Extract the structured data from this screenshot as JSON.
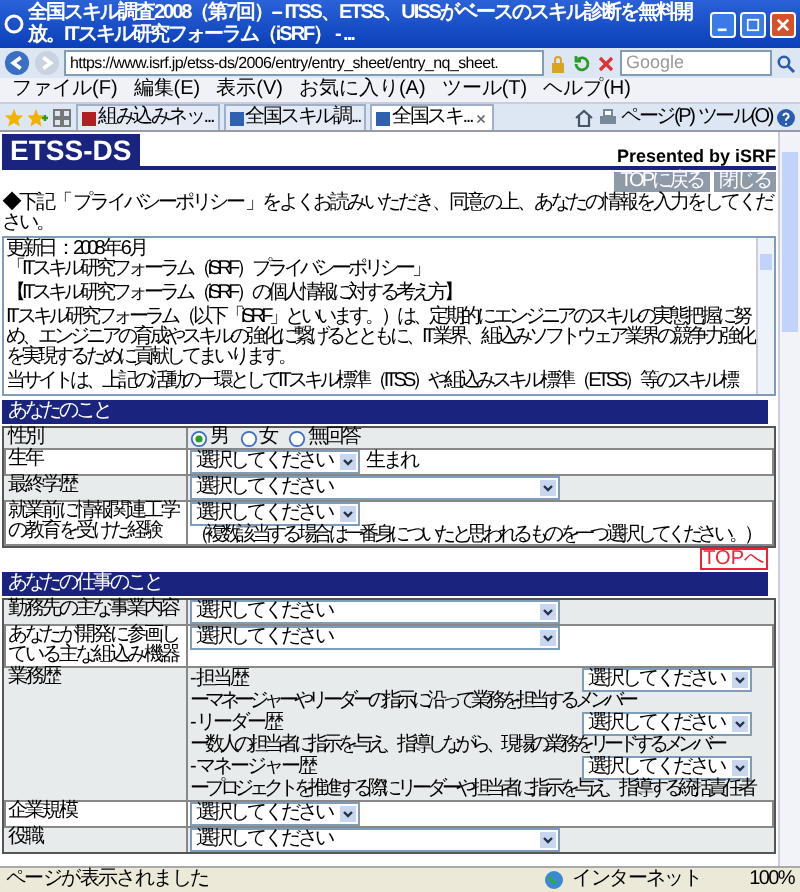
{
  "window": {
    "title": "全国スキル調査2008（第7回）-- ITSS、ETSS、UISSがベースのスキル診断を無料開放。ITスキル研究フォーラム（iSRF） - ..."
  },
  "address_bar": {
    "url": "https://www.isrf.jp/etss-ds/2006/entry/entry_sheet/entry_nq_sheet.",
    "search_placeholder": "Google"
  },
  "menu": [
    "ファイル(F)",
    "編集(E)",
    "表示(V)",
    "お気に入り(A)",
    "ツール(T)",
    "ヘルプ(H)"
  ],
  "tabs": [
    {
      "label": "組み込みネッ...",
      "selected": false
    },
    {
      "label": "全国スキル調...",
      "selected": false
    },
    {
      "label": "全国スキ...",
      "selected": true
    }
  ],
  "toolbar": [
    "ページ(P)",
    "ツール(O)"
  ],
  "page": {
    "logo": "ETSS-DS",
    "presented_by": "Presented by iSRF",
    "buttons": [
      "TOPに戻る",
      "閉じる"
    ],
    "instruction": "◆下記「 プライバシーポリシー 」をよくお読みいただき、同意の上、あなたの情報を入力をしてください。",
    "policy_paragraphs": [
      [
        "更新日 ： 2008 年 6 月",
        "「ITスキル研究フォーラム（iSRF）プライバシーポリシー」"
      ],
      [
        "【ITスキル研究フォーラム（iSRF）の個人情報に対する考え方】"
      ],
      [
        "IT スキル研究フォーラム（以下「iSRF」といいます。）は、定期的にエンジニアのスキルの実態把握に努め、エンジニアの育成やスキルの強化に繋げるとともに、IT 業界、組込みソフトウェア業界の競争力強化を実現するために貢献してまいります。"
      ],
      [
        "当サイトは、上記の活動の一環としてITスキル標準（ITSS）や組込みスキル標準（ETSS）等のスキル標"
      ]
    ],
    "sections": [
      {
        "title": "あなたのこと",
        "top_link": "TOPへ",
        "rows": [
          {
            "kind": "radio",
            "label": "性別",
            "options": [
              {
                "label": "男",
                "selected": true
              },
              {
                "label": "女",
                "selected": false
              },
              {
                "label": "無回答",
                "selected": false
              }
            ]
          },
          {
            "kind": "select",
            "label": "生年",
            "select": {
              "value": "選択してください",
              "wide": false
            },
            "suffix": "生まれ"
          },
          {
            "kind": "select",
            "label": "最終学歴",
            "select": {
              "value": "選択してください",
              "wide": true
            }
          },
          {
            "kind": "select",
            "label": "就業前に情報関連工学の教育を受けた経験",
            "select": {
              "value": "選択してください",
              "wide": false
            },
            "note": "（複数該当する場合は一番身についたと思われるものを一つ選択してください。）"
          }
        ]
      },
      {
        "title": "あなたの仕事のこと",
        "rows": [
          {
            "kind": "select",
            "label": "勤務先の主な事業内容",
            "select": {
              "value": "選択してください",
              "wide": true
            }
          },
          {
            "kind": "select",
            "label": "あなたが開発に参画している主な組込み機器",
            "select": {
              "value": "選択してください",
              "wide": true
            }
          },
          {
            "kind": "career",
            "label": "業務歴",
            "items": [
              {
                "label": "- 担当歴",
                "select": {
                  "value": "選択してください",
                  "wide": false
                },
                "note": "ーマネージャーやリーダーの指示に沿って業務を担当するメンバー"
              },
              {
                "label": "- リーダー歴",
                "select": {
                  "value": "選択してください",
                  "wide": false
                },
                "note": "ー数人の担当者に指示を与え、指導しながら、現場の業務をリードするメンバー"
              },
              {
                "label": "- マネージャー歴",
                "select": {
                  "value": "選択してください",
                  "wide": false
                },
                "note": "ープロジェクトを推進する際にリーダーや担当者に指示を与え、指導する統括責任者"
              }
            ]
          },
          {
            "kind": "select",
            "label": "企業規模",
            "select": {
              "value": "選択してください",
              "wide": false
            }
          },
          {
            "kind": "select",
            "label": "役職",
            "select": {
              "value": "選択してください",
              "wide": true
            }
          }
        ]
      }
    ]
  },
  "status_bar": {
    "text": "ページが表示されました",
    "zone": "インターネット",
    "zoom": "100%"
  }
}
